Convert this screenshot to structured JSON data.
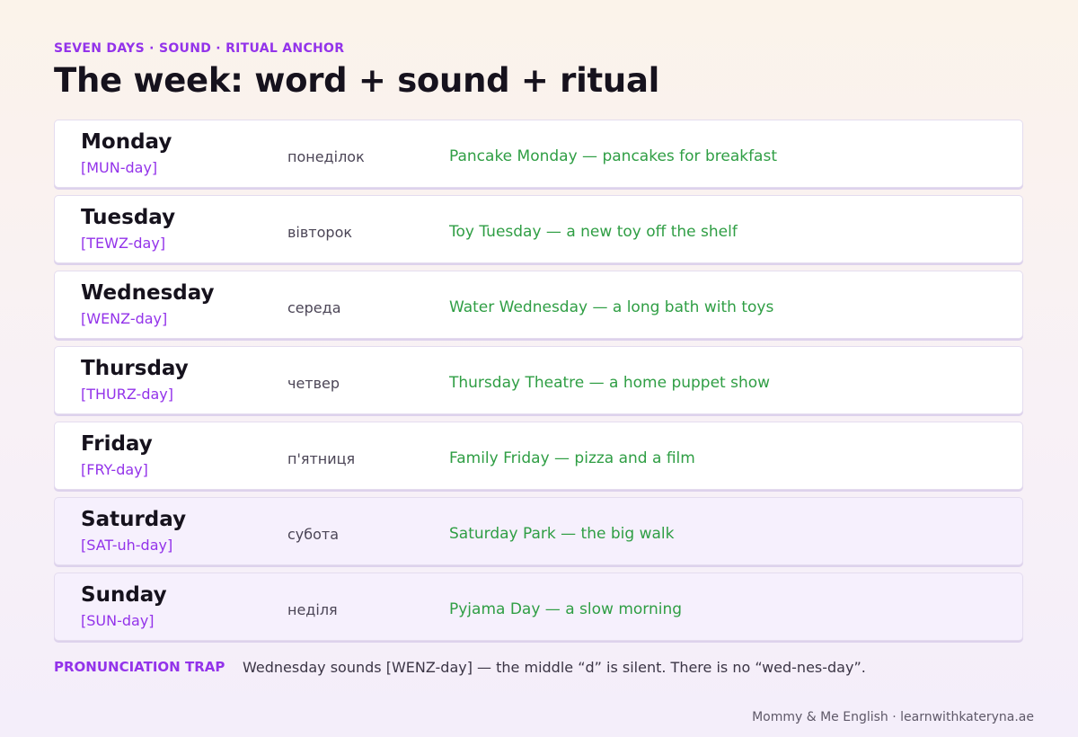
{
  "header": {
    "eyebrow": "SEVEN DAYS · SOUND · RITUAL ANCHOR",
    "title": "The week: word + sound + ritual"
  },
  "days": [
    {
      "name": "Monday",
      "pronunciation": "[MUN-day]",
      "ukrainian": "понеділок",
      "ritual": "Pancake Monday — pancakes for breakfast",
      "weekend": false
    },
    {
      "name": "Tuesday",
      "pronunciation": "[TEWZ-day]",
      "ukrainian": "вівторок",
      "ritual": "Toy Tuesday — a new toy off the shelf",
      "weekend": false
    },
    {
      "name": "Wednesday",
      "pronunciation": "[WENZ-day]",
      "ukrainian": "середа",
      "ritual": "Water Wednesday — a long bath with toys",
      "weekend": false
    },
    {
      "name": "Thursday",
      "pronunciation": "[THURZ-day]",
      "ukrainian": "четвер",
      "ritual": "Thursday Theatre — a home puppet show",
      "weekend": false
    },
    {
      "name": "Friday",
      "pronunciation": "[FRY-day]",
      "ukrainian": "п'ятниця",
      "ritual": "Family Friday — pizza and a film",
      "weekend": false
    },
    {
      "name": "Saturday",
      "pronunciation": "[SAT-uh-day]",
      "ukrainian": "субота",
      "ritual": "Saturday Park — the big walk",
      "weekend": true
    },
    {
      "name": "Sunday",
      "pronunciation": "[SUN-day]",
      "ukrainian": "неділя",
      "ritual": "Pyjama Day — a slow morning",
      "weekend": true
    }
  ],
  "trap": {
    "label": "PRONUNCIATION TRAP",
    "text": "Wednesday sounds [WENZ-day] — the middle “d” is silent. There is no “wed-nes-day”."
  },
  "footer": {
    "text": "Mommy & Me English · learnwithkateryna.ae"
  },
  "colors": {
    "accent": "#9333ea",
    "ritual": "#2f9e44",
    "weekend_row": "#f6f0fd"
  }
}
